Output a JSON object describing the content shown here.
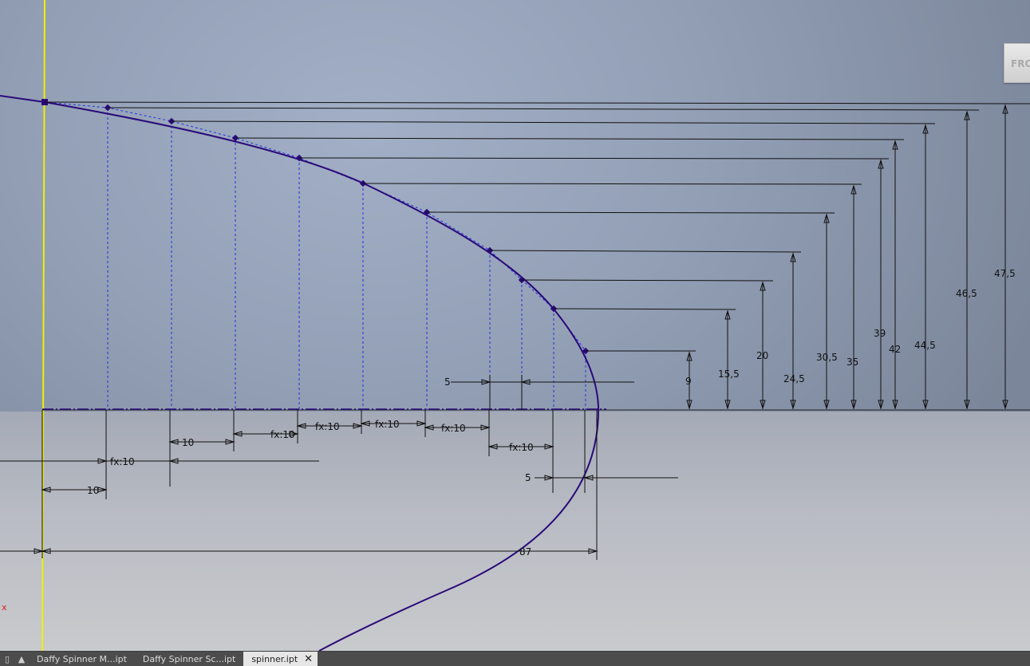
{
  "dimensions": {
    "horizontal": [
      "10",
      "fx:10",
      "10",
      "fx:10",
      "fx:10",
      "fx:10",
      "fx:10",
      "fx:10",
      "5",
      "5",
      "87"
    ],
    "vertical": [
      "9",
      "15,5",
      "20",
      "24,5",
      "30,5",
      "35",
      "39",
      "42",
      "44,5",
      "46,5",
      "47,5"
    ]
  },
  "viewcube": {
    "label": "FRO"
  },
  "axis": {
    "x_label": "x"
  },
  "tabs": [
    {
      "label": "Daffy Spinner M...ipt",
      "active": false
    },
    {
      "label": "Daffy Spinner Sc...ipt",
      "active": false
    },
    {
      "label": "spinner.ipt",
      "active": true
    }
  ],
  "colors": {
    "curve": "#2a0a7a",
    "construction": "#2233dd",
    "dimension": "#111111",
    "axis_line": "#f0f000"
  }
}
